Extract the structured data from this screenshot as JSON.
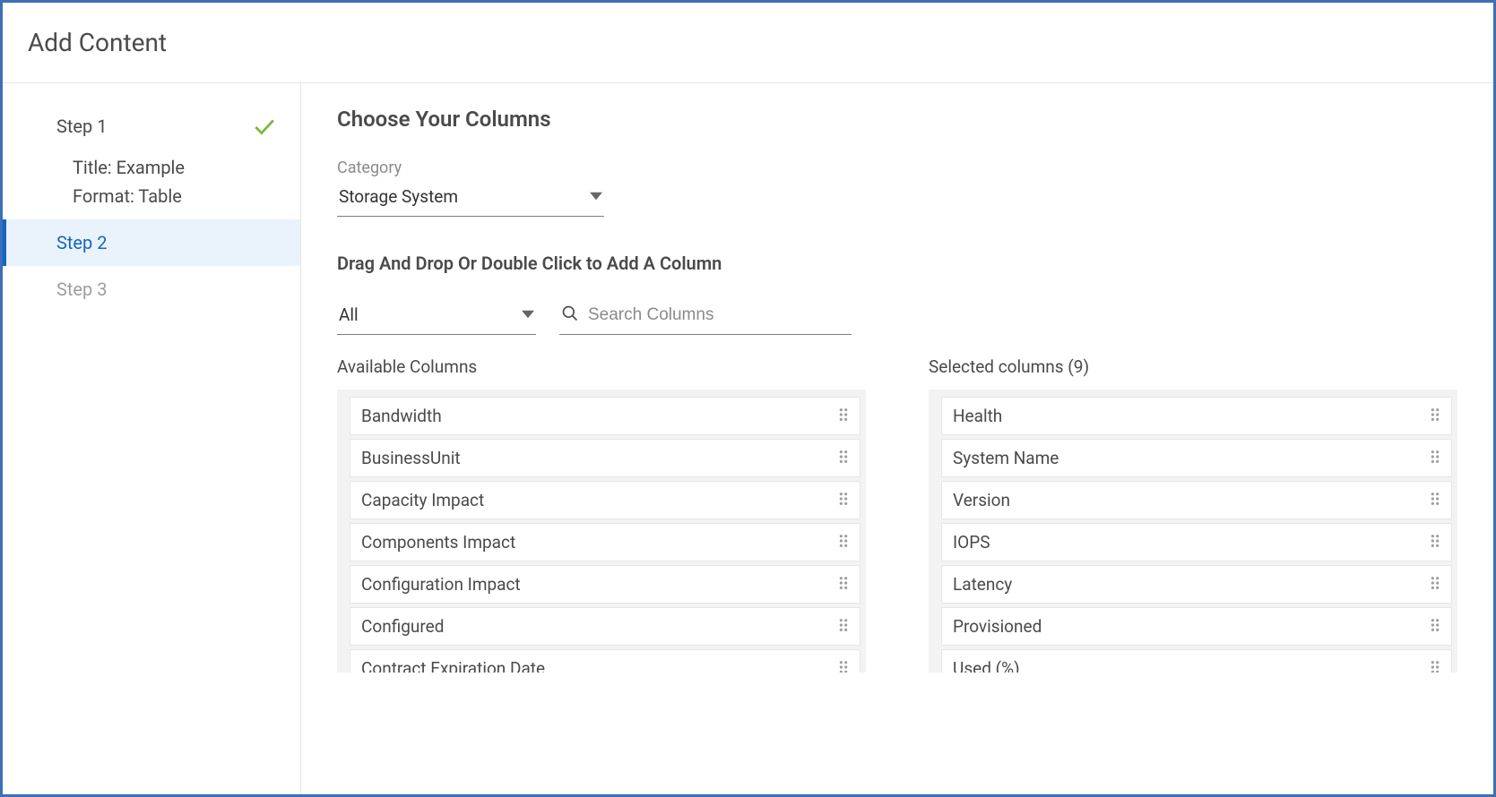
{
  "header": {
    "title": "Add Content"
  },
  "sidebar": {
    "step1": {
      "label": "Step 1",
      "title_line": "Title: Example",
      "format_line": "Format: Table"
    },
    "step2": {
      "label": "Step 2"
    },
    "step3": {
      "label": "Step 3"
    }
  },
  "main": {
    "heading": "Choose Your Columns",
    "category_label": "Category",
    "category_value": "Storage System",
    "instructions": "Drag And Drop Or Double Click to Add A Column",
    "filter_value": "All",
    "search_placeholder": "Search Columns",
    "available_title": "Available Columns",
    "selected_title": "Selected columns (9)",
    "available_columns": [
      "Bandwidth",
      "BusinessUnit",
      "Capacity Impact",
      "Components Impact",
      "Configuration Impact",
      "Configured",
      "Contract Expiration Date"
    ],
    "selected_columns": [
      "Health",
      "System Name",
      "Version",
      "IOPS",
      "Latency",
      "Provisioned",
      "Used (%)"
    ]
  }
}
